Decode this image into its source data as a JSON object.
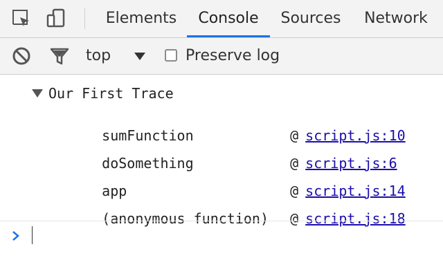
{
  "tabs": [
    {
      "label": "Elements",
      "active": false
    },
    {
      "label": "Console",
      "active": true
    },
    {
      "label": "Sources",
      "active": false
    },
    {
      "label": "Network",
      "active": false
    }
  ],
  "toolbar": {
    "icons": [
      "clear-console-icon",
      "filter-icon"
    ],
    "context_label": "top",
    "preserve_log_label": "Preserve log",
    "preserve_log_checked": false
  },
  "console": {
    "group_title": "Our First Trace",
    "frames": [
      {
        "function": "sumFunction",
        "location": "script.js:10"
      },
      {
        "function": "doSomething",
        "location": "script.js:6"
      },
      {
        "function": "app",
        "location": "script.js:14"
      },
      {
        "function": "(anonymous function)",
        "location": "script.js:18"
      }
    ],
    "at_symbol": "@",
    "prompt_icon": "chevron-right-icon"
  },
  "colors": {
    "accent": "#1a73e8",
    "link": "#1a0dab"
  }
}
